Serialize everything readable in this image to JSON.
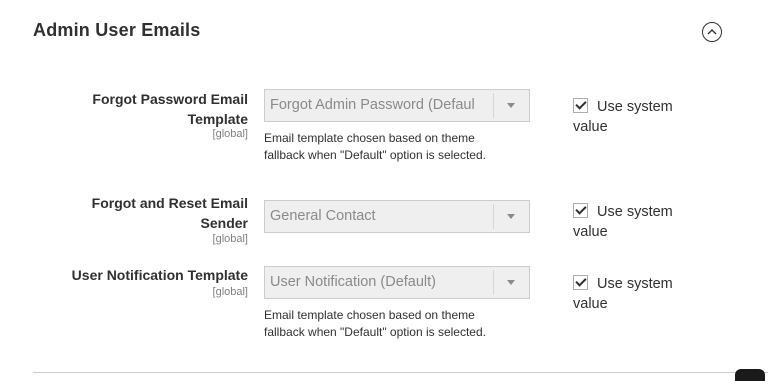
{
  "section": {
    "title": "Admin User Emails",
    "collapse_icon": "chevron-up-icon"
  },
  "fields": [
    {
      "label_line1": "Forgot Password Email",
      "label_line2": "Template",
      "scope": "[global]",
      "select_value": "Forgot Admin Password (Default)",
      "note_line1": "Email template chosen based on theme",
      "note_line2": "fallback when \"Default\" option is selected.",
      "checkbox_line1": "Use system",
      "checkbox_line2": "value",
      "checked": true
    },
    {
      "label_line1": "Forgot and Reset Email",
      "label_line2": "Sender",
      "scope": "[global]",
      "select_value": "General Contact",
      "checkbox_line1": "Use system",
      "checkbox_line2": "value",
      "checked": true
    },
    {
      "label_line1": "User Notification Template",
      "scope": "[global]",
      "select_value": "User Notification (Default)",
      "note_line1": "Email template chosen based on theme",
      "note_line2": "fallback when \"Default\" option is selected.",
      "checkbox_line1": "Use system",
      "checkbox_line2": "value",
      "checked": true
    }
  ]
}
